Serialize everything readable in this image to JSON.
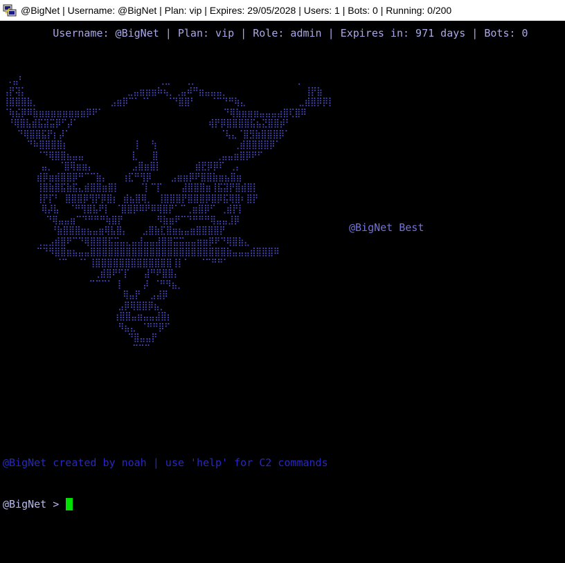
{
  "window": {
    "title": "@BigNet | Username: @BigNet | Plan: vip | Expires: 29/05/2028 | Users: 1 | Bots: 0 | Running: 0/200",
    "icon": "putty-terminal-icon"
  },
  "terminal": {
    "status_line": "        Username: @BigNet | Plan: vip | Role: admin | Expires in: 971 days | Bots: 0",
    "ascii_art": " .⣤⠃                            ⢀⣀   ⢀⡀                     ⡀\n⢠⡟⢽⡅                     ⣀⣤⣶⣶⣶⠷⢦⡀⢀⣤⠾⠛⣶⣤⣤⣤⡀                ⢸⡟⣷\n⢸⣿⣿⣿⣷⡀               ⣠⣶⡿⠉⠁⠈⠁   ⠈⠙⣿⣿⠃   ⠈⠉⠙⠛⢷⣄           ⣀⣾⣿⡿⡿⡇\n⠈⢷⣮⡿⠿⣷⣶⣶⣶⣶⣶⣶⣶⣶⡿⠟⠁                         ⠙⢿⣷⣶⣶⣶⣤⣤⣤⣴⣿⢏⣿⠿\n ⠘⢿⣿⣧⣾⣯⣽⣭⡿⠋⡼⠁                           ⢾⡟⡿⣿⣿⣿⣿⣯⣦⣝⣿⣿⡾⠃\n   ⠙⢿⣿⣿⣯⡟⡆⡼⠁                               ⠈⢧⣄⠈⣿⣻⣷⣿⣿⣿⡿⠁\n     ⠙⠷⣿⣿⣿⣿⡆              ⡇  ⢳                ⢀⣾⣿⣿⣿⣿⡿⠁\n       ⠈⠙⢿⣿⣿⣦⣤⣤          ⣇   ⣿            ⢀⣤⣤⣶⣿⡿⠟⠋\n        ⣤⡀ ⠈⣿⢿⣶⣶⡄        ⣠⣿⣶⣿⡇       ⣾⣟⡿⡿⠏ ⢀⡄\n       ⣾⡿⣶⣾⣿⣿⡿⠛⠉⠉⣷⡄   ⢰⣏⠛⢻⡿    ⣠⣶⣶⡿⠟⣿⣿⣷⣶⣦⣿⣶\n       ⢸⣿⣷⣿⣯⣷⣯⣄⣾⣿⣿⣶⣿⡇    ⠈⡇⠉⡏    ⣼⣿⣿⣿⣶⢸⣯⣽⡟⣿⣾⣿⡇\n       ⢸⡟⡏⠃ ⣿⣿⣿⡿⢻⡟⡿⣿⡆ ⣾⣦⣿⢿⡀ ⢸⣿⣿⣿⡟⣿⣿⣿⡿⣿⡿⣯⢿⣿⠆⣿⡟\n        ⢿⡼⣧  ⠈⠛⢻⣿⣧⠟⡇ ⠈⣿⣿⡿⠿⠟⠿⢿⣿⡟⠁⠉⢀⣶⣿⡿⠋ ⢀⣾⡟⡇\n         ⠙⢿⣤⣤⣶⠉⠙⠛⠛⠛⢷⣿⡟       ⠻⣷⣶⠟⠉⠙⠛⠛⠛⢿⣤⣤⣸⡿\n          ⠘⣷⣿⣿⣿⣶⣦⣤⣶⢿⣧⣿⡄   ⣠⣿⣷⣏⣿⣶⣦⣤⣶⣿⣿⣿⣿⡟\n       ⢀⣀⣠⣾⣿⠟⠉⠙⢿⣿⣿⣿⣯⣭⣤⣄⣤⣼⣤⣤⣼⣿⣿⣭⣭⣤⣤⣶⣶⡿⠟⠙⢿⣿⣷⣄\n       ⠉⠙⠻⣿⣿⣶⣦⣤⣤⣿⣿⣿⣿⣿⣿⣿⣿⣿⣿⣿⣿⣿⣿⣿⣿⣿⣿⣿⣿⣿⣿⣿⣷⣤⣤⣤⣾⣿⣿⣿⠿\n           ⠈⠉  ⠈⠁⢸⣿⣿⣿⣿⣿⣿⣿⣿⣿⣿⣿⣿⣿⢸⡇⠁  ⠈⠉⠛⠛⠁\n                   ⢀⣾⣿⠟⠋⡏   ⣼⠛⠟⣿⣿⡄\n                  ⠉⠉⠉⠁ ⡇    ⡼ ⠈⠛⠻⣦⡀\n                         ⢿⣤⡟  ⣠⣼⡿\n                        ⣠⡿⢿⣿⣿⡿⣦⡀\n                       ⢰⣿⣿⣤⣶⣤⣤⣼⣿⡆\n                        ⠻⣦⣄ ⠈⠛⠛⡿⠋\n                          ⠙⣿⣤⣤⡟\n                           ⠉⠉⠉",
    "tagline": "@BigNet Best",
    "created_line": "@BigNet created by noah | use 'help' for C2 commands",
    "prompt": "@BigNet >"
  }
}
